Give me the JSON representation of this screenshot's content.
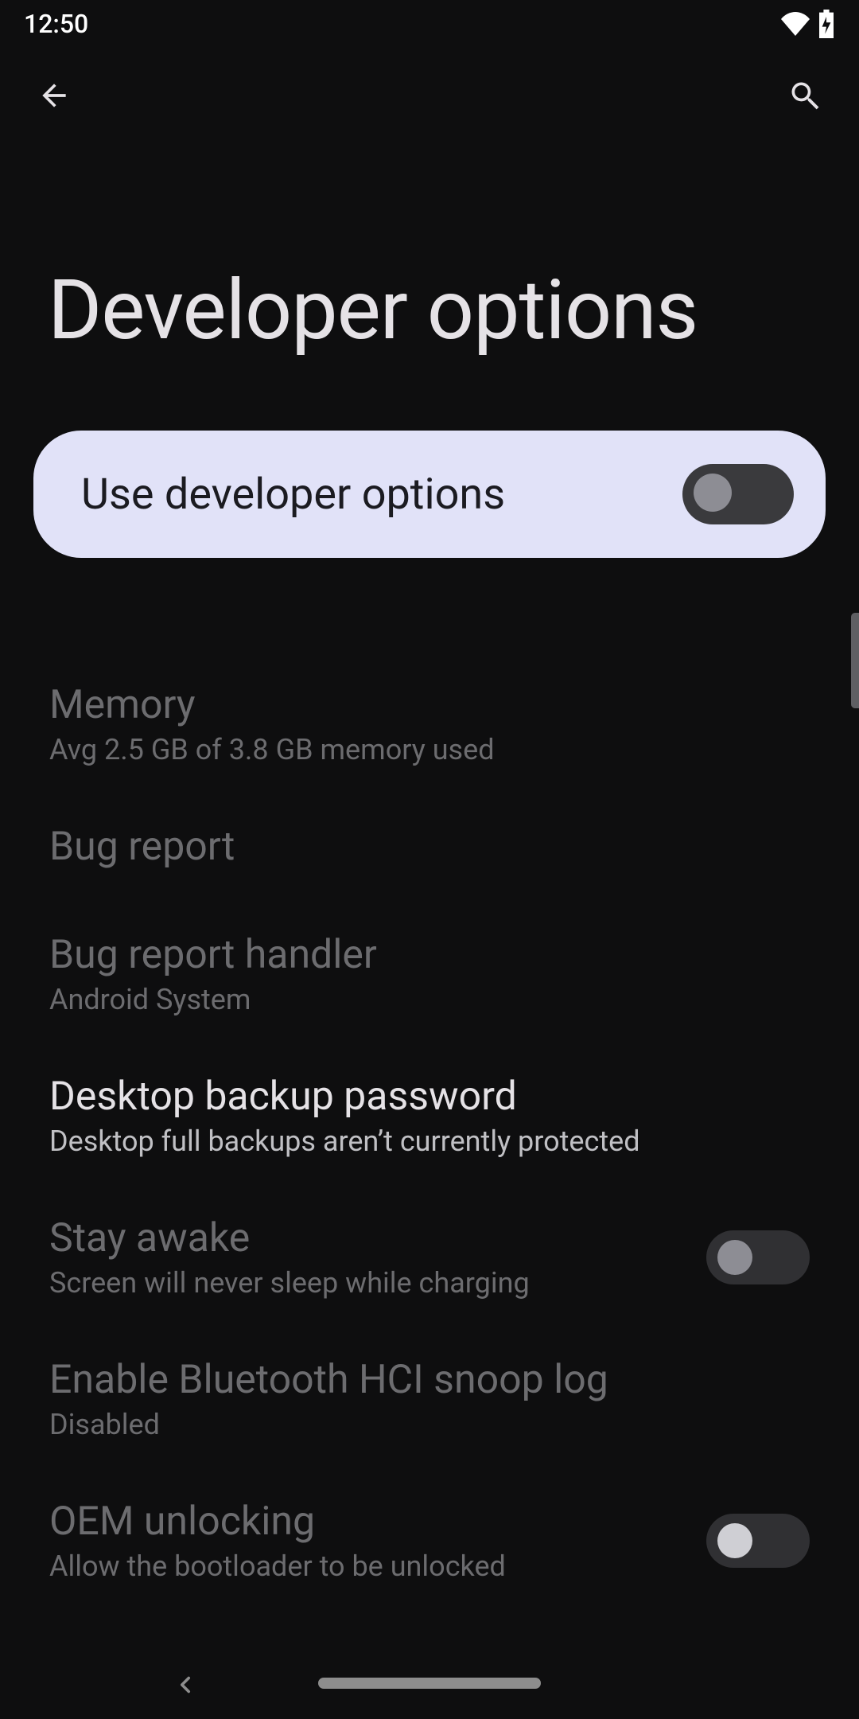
{
  "status": {
    "time": "12:50"
  },
  "page": {
    "title": "Developer options"
  },
  "master": {
    "label": "Use developer options",
    "checked": false
  },
  "items": [
    {
      "key": "memory",
      "title": "Memory",
      "sub": "Avg 2.5 GB of 3.8 GB memory used",
      "disabled": true
    },
    {
      "key": "bug-report",
      "title": "Bug report",
      "sub": "",
      "disabled": true
    },
    {
      "key": "bug-report-handler",
      "title": "Bug report handler",
      "sub": "Android System",
      "disabled": true
    },
    {
      "key": "desktop-backup-password",
      "title": "Desktop backup password",
      "sub": "Desktop full backups aren’t currently protected",
      "disabled": false
    },
    {
      "key": "stay-awake",
      "title": "Stay awake",
      "sub": "Screen will never sleep while charging",
      "disabled": true,
      "toggle": true,
      "toggle_on": false
    },
    {
      "key": "bt-hci-snoop",
      "title": "Enable Bluetooth HCI snoop log",
      "sub": "Disabled",
      "disabled": true
    },
    {
      "key": "oem-unlocking",
      "title": "OEM unlocking",
      "sub": "Allow the bootloader to be unlocked",
      "disabled": true,
      "toggle": true,
      "toggle_on": false,
      "cut_off": true
    }
  ]
}
